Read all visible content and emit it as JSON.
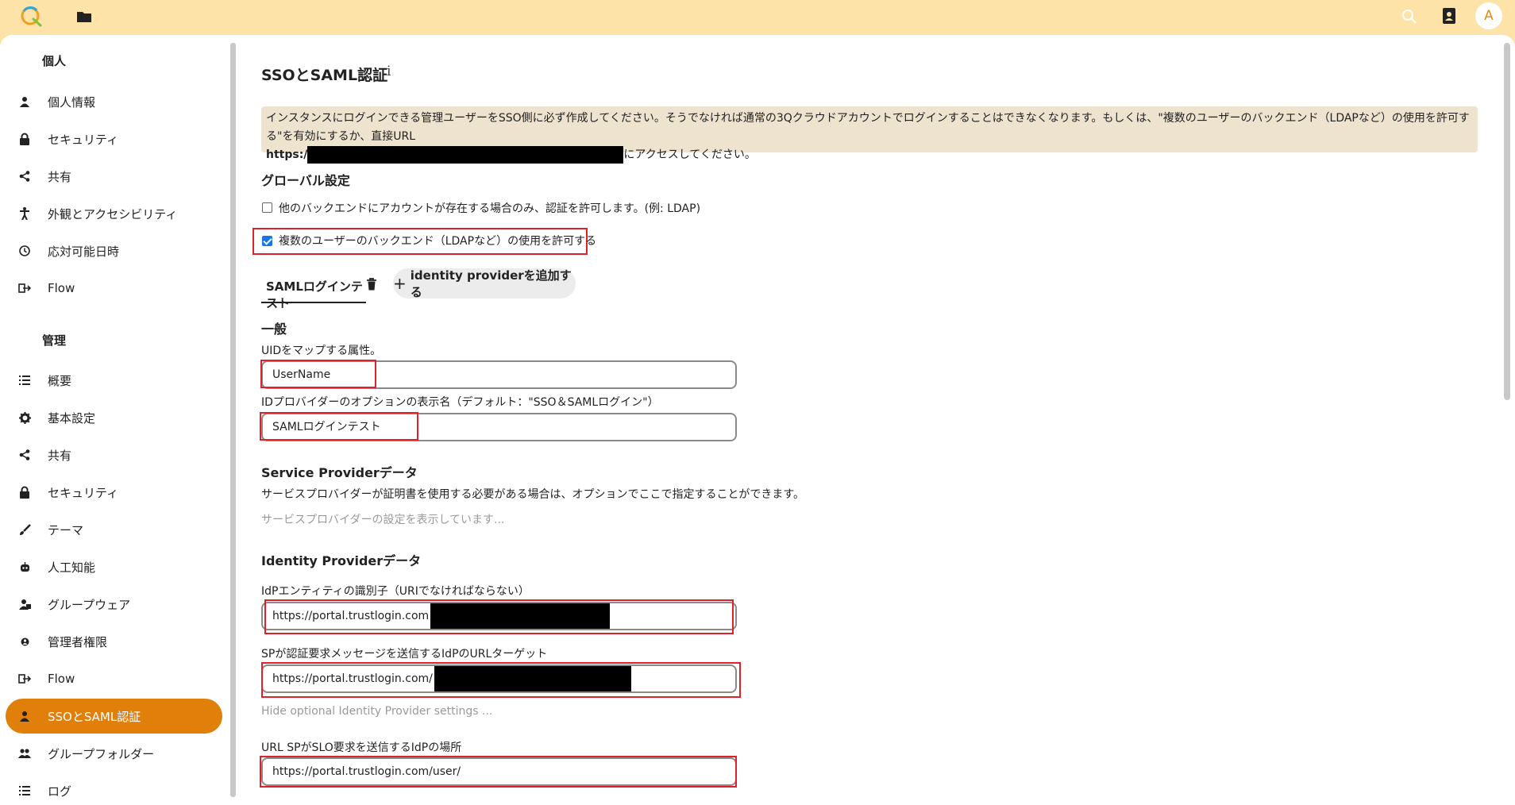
{
  "topbar": {
    "logo_icon": "qcloud-logo-icon",
    "folder_icon": "folder-icon",
    "search_icon": "search-icon",
    "contacts_icon": "contacts-icon",
    "avatar_letter": "A"
  },
  "sidebar": {
    "personal_heading": "個人",
    "personal_items": [
      {
        "label": "個人情報",
        "icon": "person-icon"
      },
      {
        "label": "セキュリティ",
        "icon": "lock-icon"
      },
      {
        "label": "共有",
        "icon": "share-icon"
      },
      {
        "label": "外観とアクセシビリティ",
        "icon": "accessibility-icon"
      },
      {
        "label": "応対可能日時",
        "icon": "clock-icon"
      },
      {
        "label": "Flow",
        "icon": "flow-icon"
      }
    ],
    "admin_heading": "管理",
    "admin_items": [
      {
        "label": "概要",
        "icon": "list-icon"
      },
      {
        "label": "基本設定",
        "icon": "gear-icon"
      },
      {
        "label": "共有",
        "icon": "share-icon"
      },
      {
        "label": "セキュリティ",
        "icon": "lock-icon"
      },
      {
        "label": "テーマ",
        "icon": "brush-icon"
      },
      {
        "label": "人工知能",
        "icon": "robot-icon"
      },
      {
        "label": "グループウェア",
        "icon": "groupware-icon"
      },
      {
        "label": "管理者権限",
        "icon": "admin-gear-icon"
      },
      {
        "label": "Flow",
        "icon": "flow-icon"
      },
      {
        "label": "SSOとSAML認証",
        "icon": "person-icon",
        "active": true
      },
      {
        "label": "グループフォルダー",
        "icon": "group-icon"
      },
      {
        "label": "ログ",
        "icon": "list-icon"
      }
    ]
  },
  "main": {
    "title": "SSOとSAML認証",
    "info_icon": "i",
    "notice_line1": "インスタンスにログインできる管理ユーザーをSSO側に必ず作成してください。そうでなければ通常の3Qクラウドアカウントでログインすることはできなくなります。もしくは、\"複数のユーザーのバックエンド（LDAPなど）の使用を許可する\"を有効にするか、直接URL",
    "notice_url_prefix": "https:/",
    "notice_suffix": "にアクセスしてください。",
    "global_heading": "グローバル設定",
    "checkbox1_label": "他のバックエンドにアカウントが存在する場合のみ、認証を許可します。(例: LDAP)",
    "checkbox1_checked": false,
    "checkbox2_label": "複数のユーザーのバックエンド（LDAPなど）の使用を許可する",
    "checkbox2_checked": true,
    "tab_label": "SAMLログインテスト",
    "trash_icon": "trash-icon",
    "add_provider_label": "identity providerを追加する",
    "general_heading": "一般",
    "uid_label": "UIDをマップする属性。",
    "uid_value": "UserName",
    "display_name_label": "IDプロバイダーのオプションの表示名（デフォルト：\"SSO＆SAMLログイン\"）",
    "display_name_value": "SAMLログインテスト",
    "sp_heading": "Service Providerデータ",
    "sp_desc": "サービスプロバイダーが証明書を使用する必要がある場合は、オプションでここで指定することができます。",
    "sp_show": "サービスプロバイダーの設定を表示しています...",
    "idp_heading": "Identity Providerデータ",
    "idp_entity_label": "IdPエンティティの識別子（URIでなければならない）",
    "idp_entity_value": "https://portal.trustlogin.com",
    "sso_url_label": "SPが認証要求メッセージを送信するIdPのURLターゲット",
    "sso_url_value": "https://portal.trustlogin.com/",
    "hide_optional": "Hide optional Identity Provider settings ...",
    "slo_label": "URL SPがSLO要求を送信するIdPの場所",
    "slo_value": "https://portal.trustlogin.com/user/"
  }
}
